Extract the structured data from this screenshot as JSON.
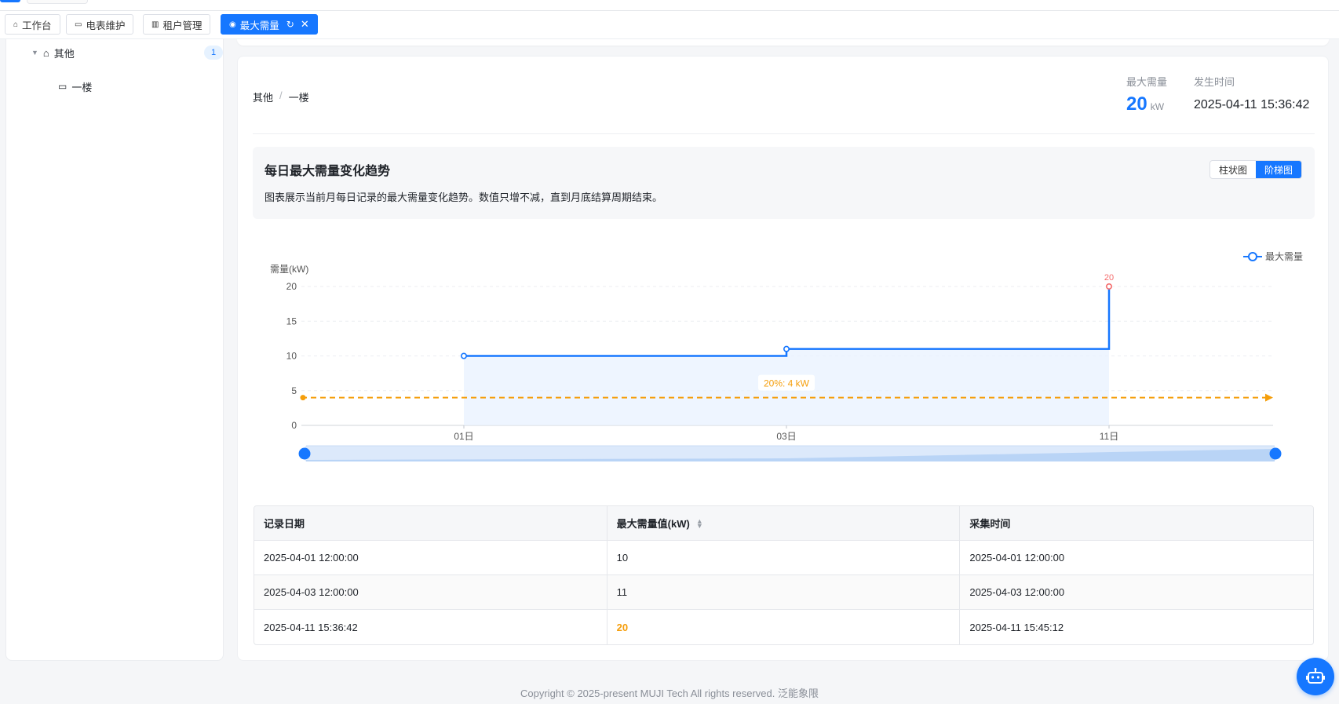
{
  "tabs": [
    {
      "label": "工作台",
      "icon": "home-icon"
    },
    {
      "label": "电表维护",
      "icon": "meter-icon"
    },
    {
      "label": "租户管理",
      "icon": "building-icon"
    },
    {
      "label": "最大需量",
      "icon": "dot-icon",
      "active": true
    }
  ],
  "sidebar": {
    "tree": [
      {
        "label": "其他",
        "count": "1",
        "expanded": true
      },
      {
        "label": "一楼"
      }
    ]
  },
  "header": {
    "breadcrumb": [
      "其他",
      "一楼"
    ],
    "max_demand_label": "最大需量",
    "max_demand_value": "20",
    "max_demand_unit": "kW",
    "occur_time_label": "发生时间",
    "occur_time_value": "2025-04-11 15:36:42"
  },
  "trend": {
    "title": "每日最大需量变化趋势",
    "description": "图表展示当前月每日记录的最大需量变化趋势。数值只增不减，直到月底结算周期结束。",
    "view_options": [
      "柱状图",
      "阶梯图"
    ],
    "selected_view": "阶梯图"
  },
  "chart_data": {
    "type": "line",
    "step": true,
    "ylabel": "需量(kW)",
    "ylim": [
      0,
      20
    ],
    "yticks": [
      "0",
      "5",
      "10",
      "15",
      "20"
    ],
    "categories": [
      "01日",
      "03日",
      "11日"
    ],
    "series": [
      {
        "name": "最大需量",
        "values": [
          10,
          11,
          20
        ],
        "color": "#1677ff"
      }
    ],
    "highlight_point": {
      "category": "11日",
      "value": 20,
      "label": "20",
      "color": "#f56c6c"
    },
    "threshold": {
      "value": 4,
      "label": "20%: 4 kW",
      "color": "#f59e0b"
    },
    "legend": "top-right",
    "grid": true
  },
  "table": {
    "headers": [
      "记录日期",
      "最大需量值(kW)",
      "采集时间"
    ],
    "rows": [
      [
        "2025-04-01 12:00:00",
        "10",
        "2025-04-01 12:00:00"
      ],
      [
        "2025-04-03 12:00:00",
        "11",
        "2025-04-03 12:00:00"
      ],
      [
        "2025-04-11 15:36:42",
        "20",
        "2025-04-11 15:45:12"
      ]
    ]
  },
  "footer": "Copyright © 2025-present MUJI Tech All rights reserved. 泛能象限"
}
